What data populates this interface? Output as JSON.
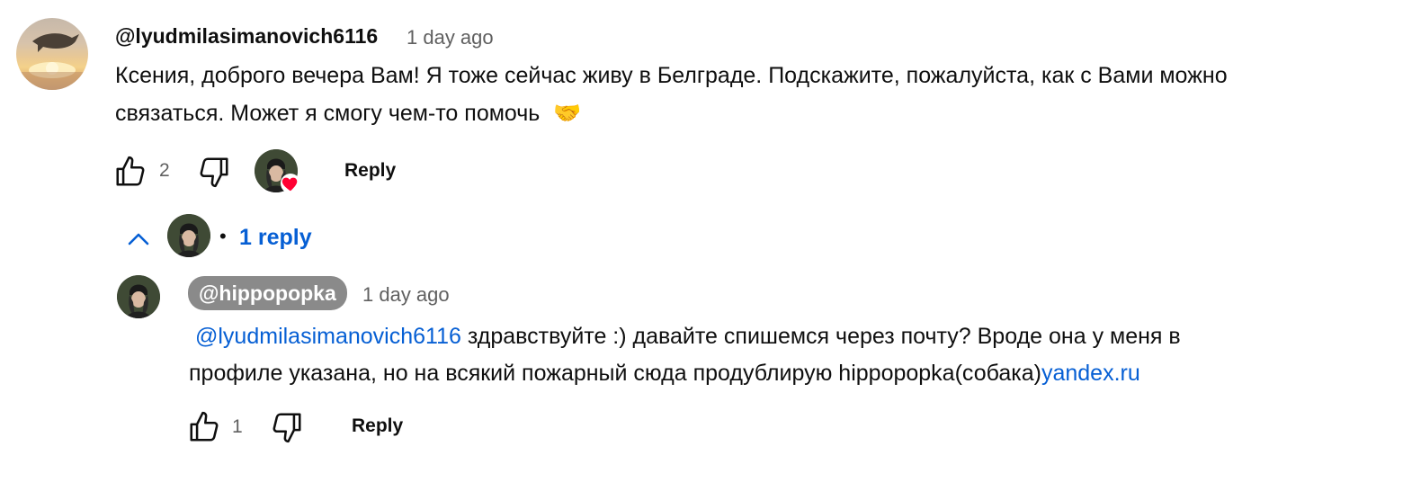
{
  "comment": {
    "author": "@lyudmilasimanovich6116",
    "time": "1 day ago",
    "text_line1": "Ксения, доброго вечера Вам! Я тоже сейчас живу в Белграде. Подскажите, пожалуйста, как с Вами можно",
    "text_line2": "связаться. Может я смогу чем-то помочь",
    "emoji": "🤝",
    "likes": "2",
    "reply_label": "Reply"
  },
  "replies_toggle": {
    "bullet": "•",
    "label": "1 reply"
  },
  "reply": {
    "author": "@hippopopka",
    "time": "1 day ago",
    "mention": "@lyudmilasimanovich6116",
    "text_part1": " здравствуйте :) давайте спишемся через почту? Вроде она у меня в",
    "text_line2": "профиле указана, но на всякий пожарный сюда продублирую hippopopka(собака)",
    "link": "yandex.ru",
    "likes": "1",
    "reply_label": "Reply"
  },
  "colors": {
    "link": "#065fd4",
    "secondary_text": "#606060",
    "author_chip": "#8a8a8a",
    "heart": "#ff0033"
  }
}
